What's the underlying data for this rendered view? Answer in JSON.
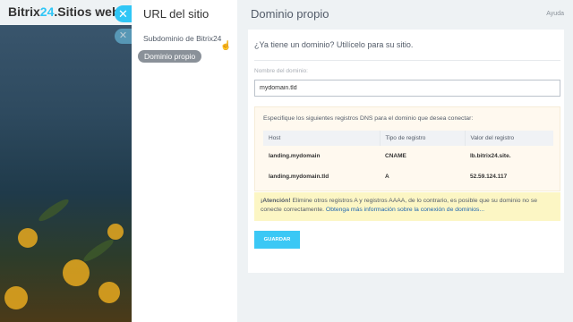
{
  "background": {
    "app_name_part1": "Bitrix",
    "app_name_num": "24",
    "app_name_part2": ".Sitios web"
  },
  "slider": {
    "close_icon": "✕",
    "menu": {
      "title": "URL del sitio",
      "items": [
        {
          "label": "Subdominio de Bitrix24"
        },
        {
          "label": "Dominio propio",
          "active": true
        }
      ]
    },
    "header": {
      "title": "Dominio propio",
      "help_label": "Ayuda"
    },
    "form": {
      "question": "¿Ya tiene un dominio? Utilícelo para su sitio.",
      "domain_label": "Nombre del dominio:",
      "domain_value": "mydomain.tld",
      "dns_instructions": "Especifique los siguientes registros DNS para el dominio que desea conectar:",
      "dns_headers": [
        "Host",
        "Tipo de registro",
        "Valor del registro"
      ],
      "dns_rows": [
        [
          "landing.mydomain",
          "CNAME",
          "lb.bitrix24.site."
        ],
        [
          "landing.mydomain.tld",
          "A",
          "52.59.124.117"
        ]
      ],
      "warning_title": "¡Atención!",
      "warning_text": " Elimine otros registros A y registros AAAA, de lo contrario, es posible que su dominio no se conecte correctamente. ",
      "warning_link": "Obtenga más información sobre la conexión de dominios...",
      "save_label": "GUARDAR"
    }
  },
  "colors": {
    "accent": "#2fc6f6",
    "save_button": "#3bc8f5",
    "active_menu": "#8a9199",
    "warning_bg": "#fcf6c4",
    "dns_bg": "#fff9ef"
  }
}
